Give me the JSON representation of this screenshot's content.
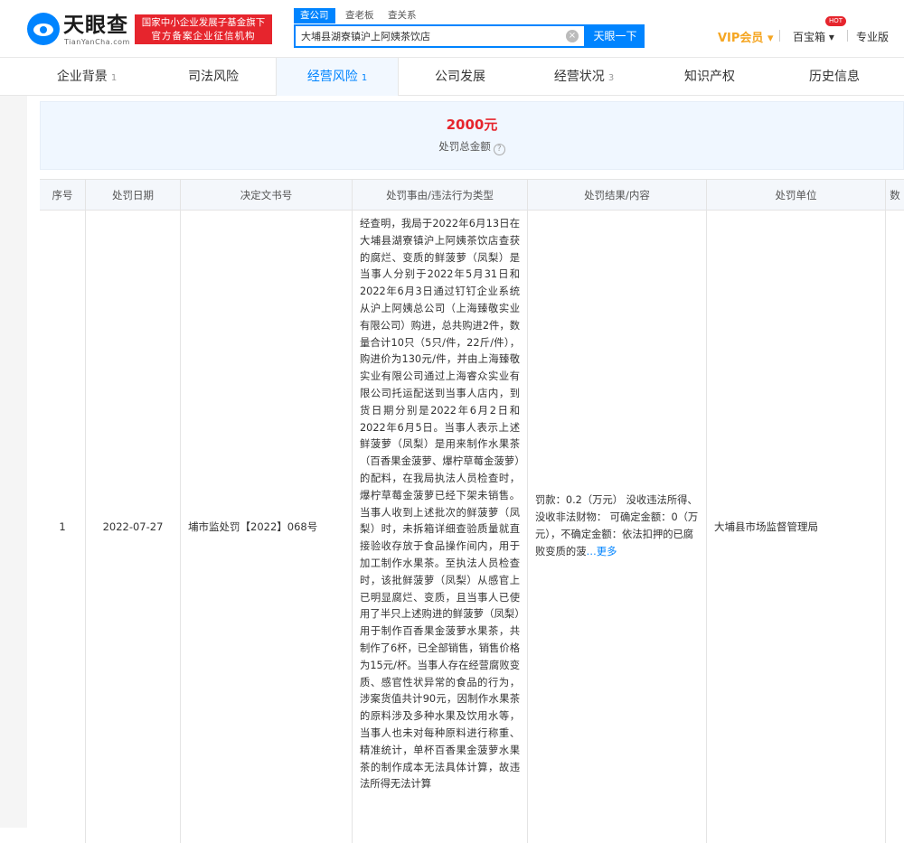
{
  "brand": {
    "name": "天眼查",
    "sub": "TianYanCha.com",
    "badge_line1": "国家中小企业发展子基金旗下",
    "badge_line2": "官方备案企业征信机构"
  },
  "search": {
    "tabs": [
      "查公司",
      "查老板",
      "查关系"
    ],
    "value": "大埔县湖寮镇沪上阿姨茶饮店",
    "button": "天眼一下"
  },
  "header_links": {
    "vip": "VIP会员 ▾",
    "toolbox": "百宝箱 ▾",
    "hot": "HOT",
    "pro": "专业版"
  },
  "nav": {
    "tabs": [
      {
        "label": "企业背景",
        "count": "1"
      },
      {
        "label": "司法风险",
        "count": ""
      },
      {
        "label": "经营风险",
        "count": "1"
      },
      {
        "label": "公司发展",
        "count": ""
      },
      {
        "label": "经营状况",
        "count": "3"
      },
      {
        "label": "知识产权",
        "count": ""
      },
      {
        "label": "历史信息",
        "count": ""
      }
    ]
  },
  "summary": {
    "amount": "2000元",
    "label": "处罚总金额"
  },
  "table": {
    "headers": [
      "序号",
      "处罚日期",
      "决定文书号",
      "处罚事由/违法行为类型",
      "处罚结果/内容",
      "处罚单位",
      "数"
    ],
    "rows": [
      {
        "index": "1",
        "date": "2022-07-27",
        "doc_no": "埔市监处罚【2022】068号",
        "reason": "经查明，我局于2022年6月13日在大埔县湖寮镇沪上阿姨茶饮店查获的腐烂、变质的鲜菠萝（凤梨）是当事人分别于2022年5月31日和2022年6月3日通过钉钉企业系统从沪上阿姨总公司（上海臻敬实业有限公司）购进，总共购进2件，数量合计10只（5只/件，22斤/件），购进价为130元/件，并由上海臻敬实业有限公司通过上海睿众实业有限公司托运配送到当事人店内，到货日期分别是2022年6月2日和2022年6月5日。当事人表示上述鲜菠萝（凤梨）是用来制作水果茶（百香果金菠萝、爆柠草莓金菠萝）的配料，在我局执法人员检查时，爆柠草莓金菠萝已经下架未销售。当事人收到上述批次的鲜菠萝（凤梨）时，未拆箱详细查验质量就直接验收存放于食品操作间内，用于加工制作水果茶。至执法人员检查时，该批鲜菠萝（凤梨）从感官上已明显腐烂、变质，且当事人已使用了半只上述购进的鲜菠萝（凤梨）用于制作百香果金菠萝水果茶，共制作了6杯，已全部销售，销售价格为15元/杯。当事人存在经营腐败变质、感官性状异常的食品的行为，涉案货值共计90元，因制作水果茶的原料涉及多种水果及饮用水等，当事人也未对每种原料进行称重、精准统计，单杯百香果金菠萝水果茶的制作成本无法具体计算，故违法所得无法计算",
        "result": "罚款：0.2（万元） 没收违法所得、没收非法财物： 可确定金额：0（万元），不确定金额：依法扣押的已腐败变质的菠",
        "result_more": "…更多",
        "unit": "大埔县市场监督管理局"
      }
    ]
  }
}
